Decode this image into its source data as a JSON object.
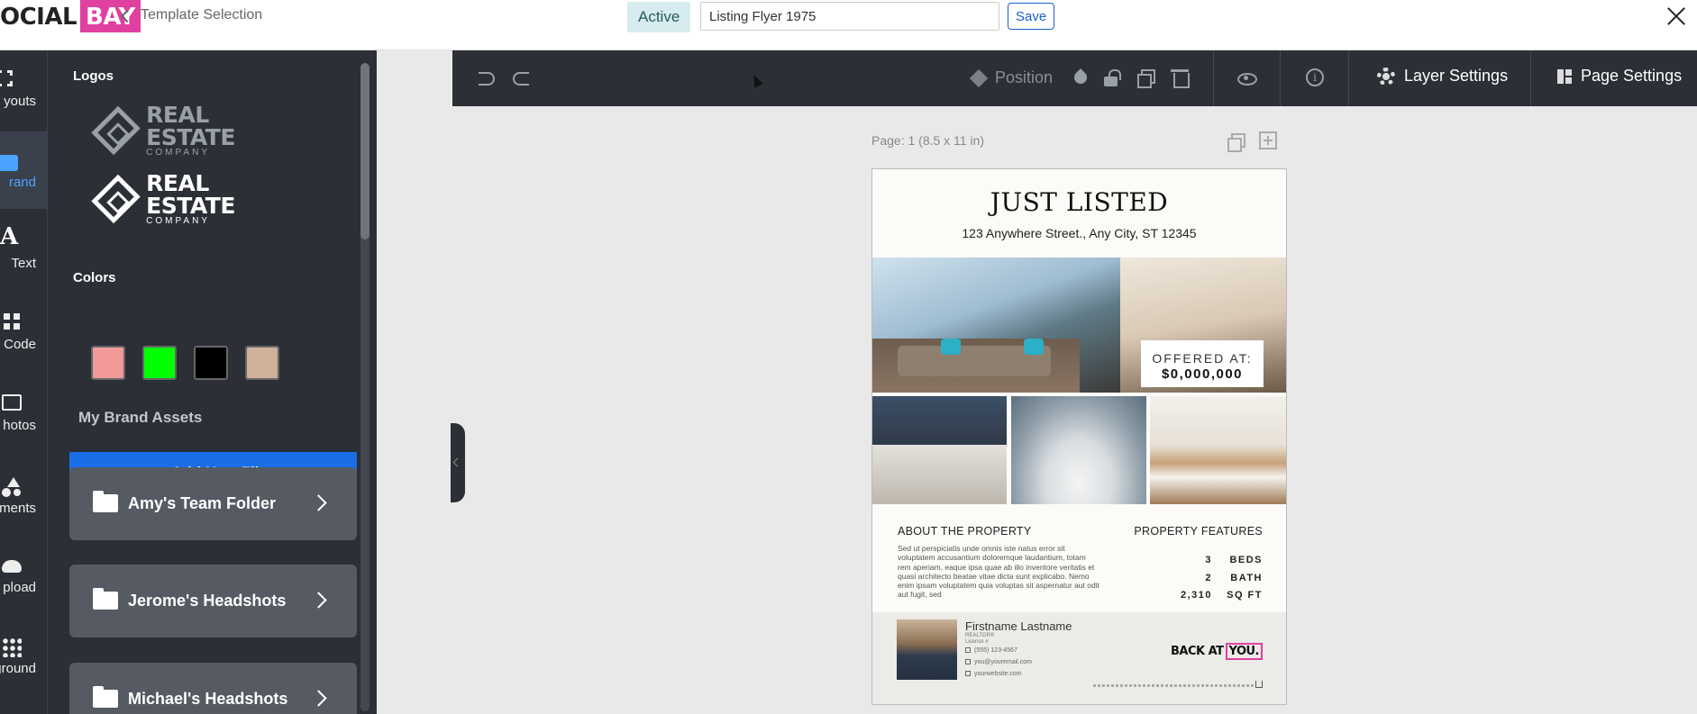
{
  "header": {
    "logo_left": "OCIAL",
    "logo_right": "BAY",
    "back_label": "Template Selection",
    "status": "Active",
    "document_name": "Listing Flyer 1975",
    "save_label": "Save",
    "accent_color": "#e040a0"
  },
  "rail": {
    "items": [
      {
        "label": "youts",
        "icon": "expand-icon"
      },
      {
        "label": "rand",
        "icon": "briefcase-icon",
        "active": true
      },
      {
        "label": "Text",
        "icon": "text-icon"
      },
      {
        "label": "t Code",
        "icon": "qr-code-icon"
      },
      {
        "label": "hotos",
        "icon": "image-icon"
      },
      {
        "label": "ements",
        "icon": "shapes-icon"
      },
      {
        "label": "pload",
        "icon": "upload-cloud-icon"
      },
      {
        "label": "kground",
        "icon": "dots-grid-icon"
      }
    ]
  },
  "panel": {
    "logos_title": "Logos",
    "logos": [
      {
        "word": "REAL ESTATE",
        "sub": "COMPANY",
        "variant": "grey"
      },
      {
        "word": "REAL ESTATE",
        "sub": "COMPANY",
        "variant": "white"
      }
    ],
    "colors_title": "Colors",
    "colors": [
      "#f29a9a",
      "#00ff00",
      "#000000",
      "#cfb09a"
    ],
    "assets_title": "My Brand Assets",
    "add_file_label": "+ Add New File",
    "folders": [
      {
        "name": "Amy's Team Folder"
      },
      {
        "name": "Jerome's Headshots"
      },
      {
        "name": "Michael's Headshots"
      }
    ]
  },
  "toolbar": {
    "position_label": "Position",
    "layer_settings_label": "Layer Settings",
    "page_settings_label": "Page Settings"
  },
  "canvas": {
    "page_label": "Page: 1 (8.5 x 11 in)",
    "flyer": {
      "title": "JUST LISTED",
      "address": "123 Anywhere Street., Any City, ST 12345",
      "offer_label": "OFFERED AT:",
      "offer_price": "$0,000,000",
      "about_heading": "ABOUT THE PROPERTY",
      "about_text": "Sed ut perspiciatis unde omnis iste natus error sit voluptatem accusantium doloremque laudantium, totam rem aperiam, eaque ipsa quae ab illo inventore veritatis et quasi architecto beatae vitae dicta sunt explicabo. Nemo enim ipsam voluptatem quia voluptas sit aspernatur aut odit aut fugit, sed",
      "features_heading": "PROPERTY FEATURES",
      "features": [
        {
          "num": "3",
          "unit": "BEDS"
        },
        {
          "num": "2",
          "unit": "BATH"
        },
        {
          "num": "2,310",
          "unit": "SQ FT"
        }
      ],
      "agent_name": "Firstname Lastname",
      "agent_title": "REALTOR®",
      "agent_license": "License #",
      "agent_phone": "(555) 123-4567",
      "agent_email": "you@youremail.com",
      "agent_website": "yourwebsite.com",
      "brand_left": "BACK AT",
      "brand_right": "YOU."
    }
  }
}
